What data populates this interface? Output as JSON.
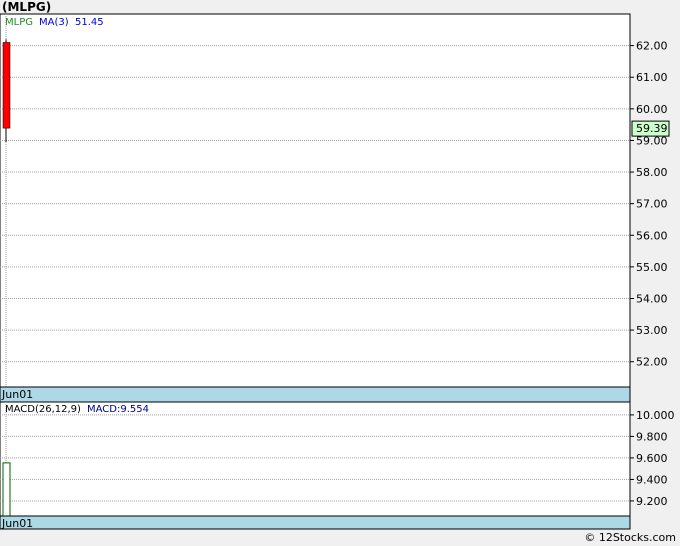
{
  "title": "(MLPG)",
  "footer": "© 12Stocks.com",
  "colors": {
    "down_candle": "#ff0000",
    "ticker_label": "#228b22",
    "ma_label": "#0000cd",
    "macd_label": "#00008b",
    "price_badge_bg": "#ccffcc",
    "date_strip": "#add8e6",
    "macd_bar": "#006400"
  },
  "chart_data": [
    {
      "type": "candlestick",
      "legend": {
        "ticker": "MLPG",
        "ma_label": "MA(3)",
        "ma_value": "51.45"
      },
      "x_labels": [
        "Jun01"
      ],
      "ylim": [
        51.2,
        63.0
      ],
      "y_ticks": [
        52,
        53,
        54,
        55,
        56,
        57,
        58,
        59,
        60,
        61,
        62
      ],
      "y_tick_labels": [
        "52.00",
        "53.00",
        "54.00",
        "55.00",
        "56.00",
        "57.00",
        "58.00",
        "59.00",
        "60.00",
        "61.00",
        "62.00"
      ],
      "candles": [
        {
          "date": "Jun01",
          "open": 62.1,
          "high": 62.2,
          "low": 58.95,
          "close": 59.39
        }
      ],
      "last_price": "59.39",
      "grid": true
    },
    {
      "type": "bar",
      "legend": {
        "name": "MACD(26,12,9)",
        "value_label": "MACD:9.554"
      },
      "x_labels": [
        "Jun01"
      ],
      "ylim": [
        9.06,
        10.12
      ],
      "y_ticks": [
        9.2,
        9.4,
        9.6,
        9.8,
        10.0
      ],
      "y_tick_labels": [
        "9.200",
        "9.400",
        "9.600",
        "9.800",
        "10.000"
      ],
      "values": [
        9.554
      ],
      "grid": true
    }
  ]
}
